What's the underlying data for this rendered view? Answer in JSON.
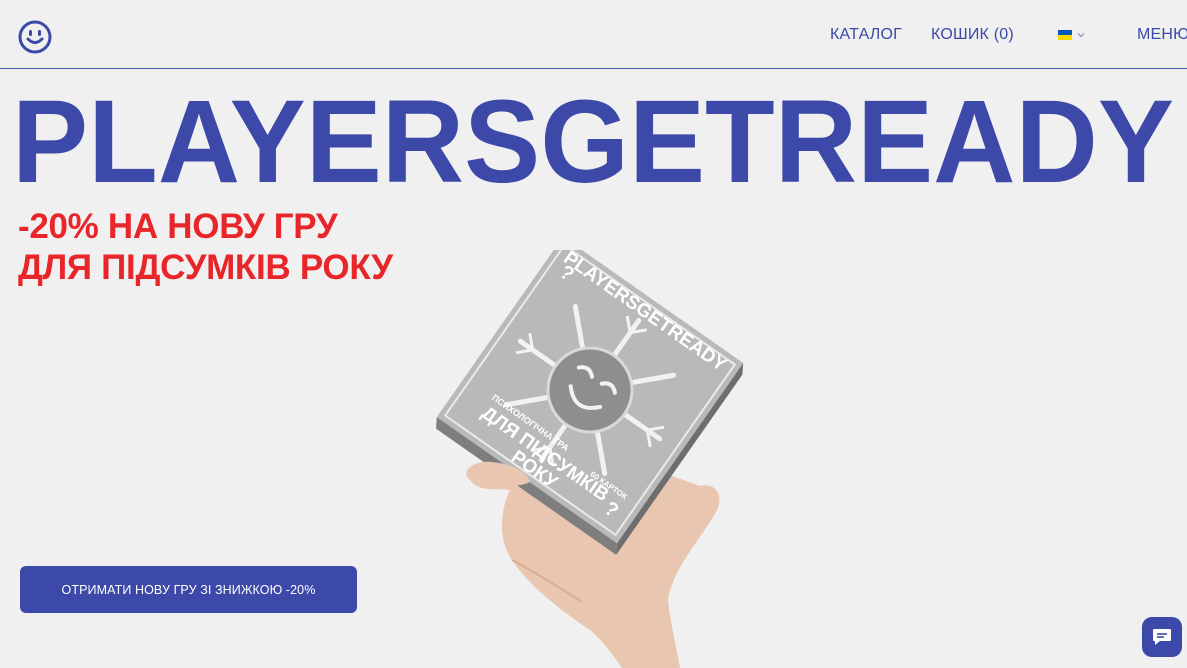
{
  "header": {
    "logo_icon": "smiley-logo-icon",
    "nav_catalog": "КАТАЛОГ",
    "nav_cart": "КОШИК (0)",
    "language_flag_icon": "ukraine-flag-icon",
    "nav_menu": "МЕНЮ"
  },
  "hero": {
    "title": "PLAYERSGETREADY",
    "promo_line_1": "-20% НА НОВУ ГРУ",
    "promo_line_2": "ДЛЯ ПІДСУМКІВ РОКУ"
  },
  "product": {
    "box_brand": "PLAYERSGETREADY",
    "box_subtitle": "ПСИХОЛОГІЧНА ГРА",
    "box_title_1": "ДЛЯ ПІДСУМКІВ",
    "box_title_2": "РОКУ",
    "box_cards": "60 КАРТОК"
  },
  "cta": {
    "label": "ОТРИМАТИ НОВУ ГРУ ЗІ ЗНИЖКОЮ -20%"
  },
  "chat": {
    "icon": "chat-bubble-icon"
  },
  "colors": {
    "brand_blue": "#3c49a8",
    "promo_red": "#e8262a",
    "background": "#f0f0f0"
  }
}
